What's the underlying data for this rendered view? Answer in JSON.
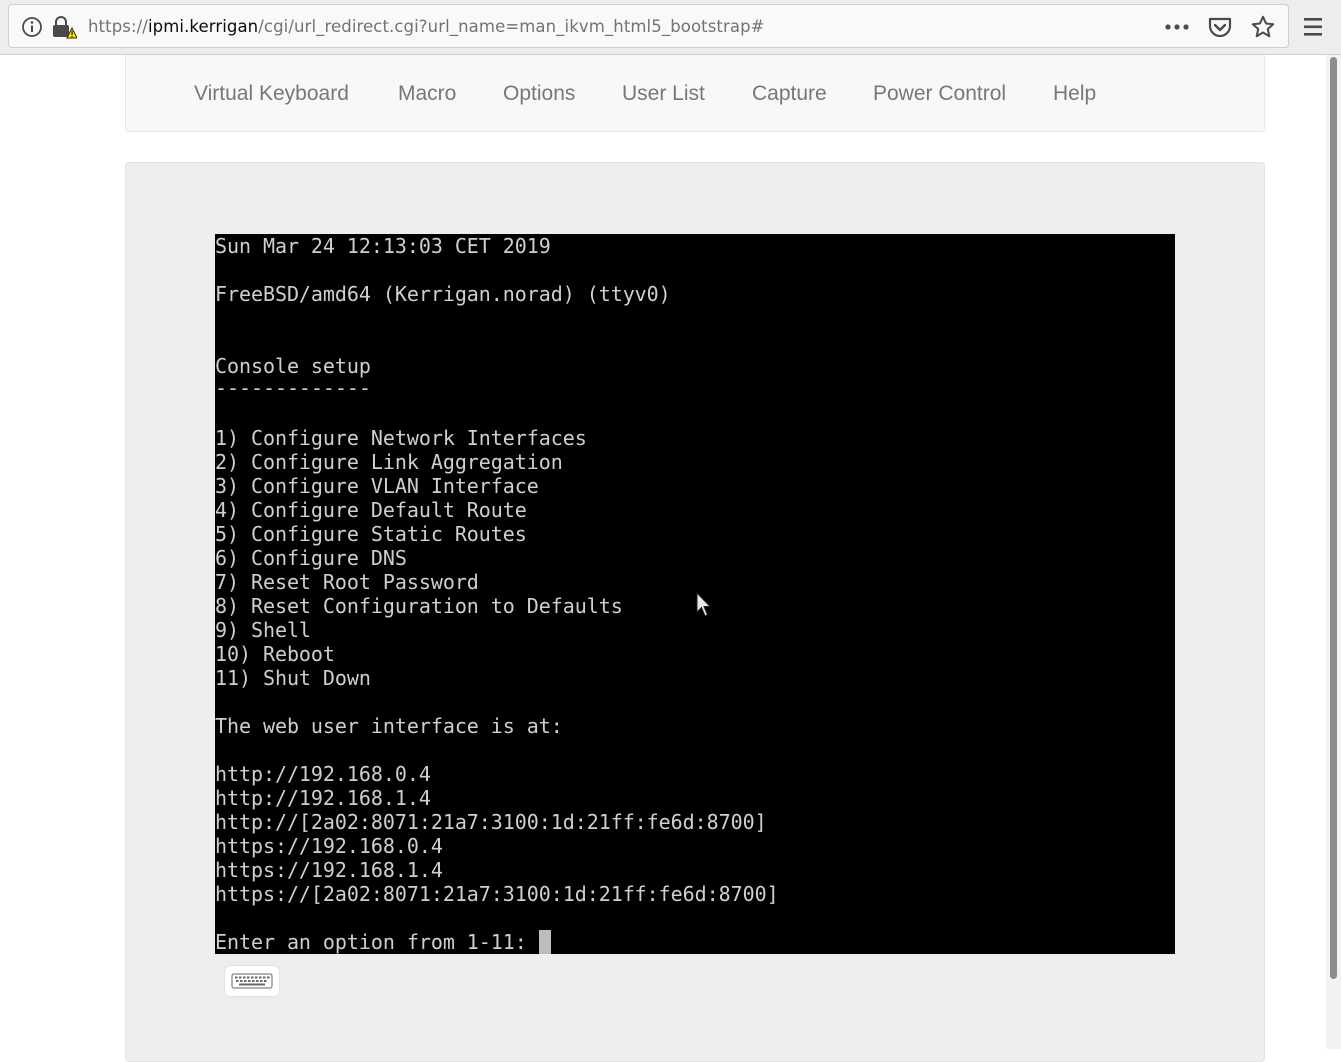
{
  "browser": {
    "url_prefix": "https://",
    "url_host": "ipmi.kerrigan",
    "url_path": "/cgi/url_redirect.cgi?url_name=man_ikvm_html5_bootstrap#",
    "icons": [
      "info-icon",
      "insecure-lock-warning-icon",
      "more-actions-icon",
      "pocket-icon",
      "bookmark-star-icon",
      "hamburger-menu-icon"
    ]
  },
  "nav": {
    "items": [
      {
        "label": "Virtual Keyboard"
      },
      {
        "label": "Macro"
      },
      {
        "label": "Options"
      },
      {
        "label": "User List"
      },
      {
        "label": "Capture"
      },
      {
        "label": "Power Control"
      },
      {
        "label": "Help"
      }
    ]
  },
  "console": {
    "lines": [
      "Sun Mar 24 12:13:03 CET 2019",
      "",
      "FreeBSD/amd64 (Kerrigan.norad) (ttyv0)",
      "",
      "",
      "Console setup",
      "-------------",
      "",
      "1) Configure Network Interfaces",
      "2) Configure Link Aggregation",
      "3) Configure VLAN Interface",
      "4) Configure Default Route",
      "5) Configure Static Routes",
      "6) Configure DNS",
      "7) Reset Root Password",
      "8) Reset Configuration to Defaults",
      "9) Shell",
      "10) Reboot",
      "11) Shut Down",
      "",
      "The web user interface is at:",
      "",
      "http://192.168.0.4",
      "http://192.168.1.4",
      "http://[2a02:8071:21a7:3100:1d:21ff:fe6d:8700]",
      "https://192.168.0.4",
      "https://192.168.1.4",
      "https://[2a02:8071:21a7:3100:1d:21ff:fe6d:8700]",
      "",
      "Enter an option from 1-11: "
    ]
  },
  "toolbar": {
    "keyboard_icon": "keyboard-icon"
  },
  "colors": {
    "console_bg": "#000000",
    "console_text": "#cfcfcf",
    "nav_text": "#777777",
    "panel_bg": "#eeeeee"
  }
}
